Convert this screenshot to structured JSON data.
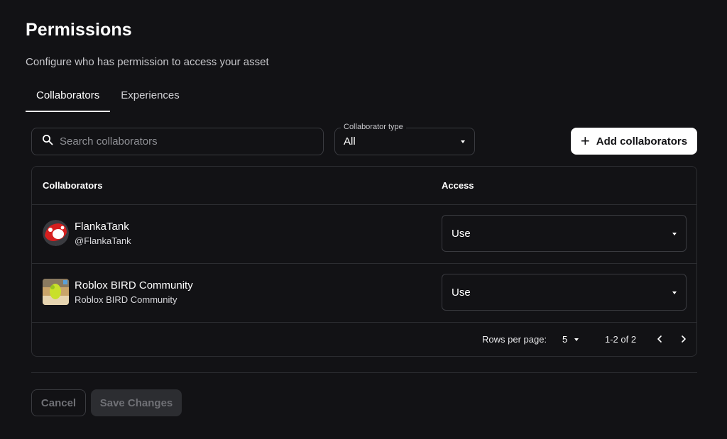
{
  "header": {
    "title": "Permissions",
    "subtitle": "Configure who has permission to access your asset"
  },
  "tabs": [
    {
      "label": "Collaborators",
      "active": true
    },
    {
      "label": "Experiences",
      "active": false
    }
  ],
  "search": {
    "placeholder": "Search collaborators",
    "value": "",
    "icon": "search-icon"
  },
  "collaborator_type": {
    "legend": "Collaborator type",
    "value": "All"
  },
  "add_button": {
    "label": "Add collaborators",
    "icon": "plus-icon"
  },
  "table": {
    "columns": [
      "Collaborators",
      "Access"
    ],
    "rows": [
      {
        "name": "FlankaTank",
        "handle": "@FlankaTank",
        "access": "Use",
        "avatar": "mushroom-avatar"
      },
      {
        "name": "Roblox BIRD Community",
        "handle": "Roblox BIRD Community",
        "access": "Use",
        "avatar": "group-thumbnail"
      }
    ],
    "pagination": {
      "rows_per_page_label": "Rows per page:",
      "rows_per_page": "5",
      "range": "1-2 of 2"
    }
  },
  "footer": {
    "cancel_label": "Cancel",
    "save_label": "Save Changes"
  },
  "colors": {
    "background": "#121215",
    "border": "#2c2d31",
    "primary_button": "#ffffff",
    "disabled_text": "#6f7075"
  }
}
